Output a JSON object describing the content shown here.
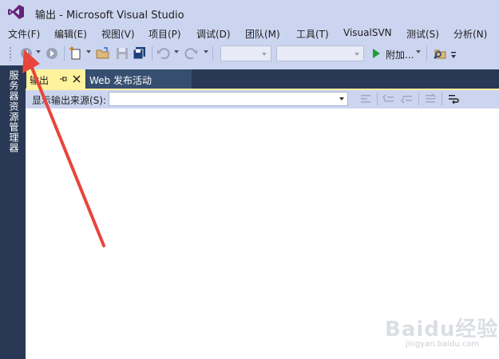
{
  "window": {
    "title": "输出 - Microsoft Visual Studio",
    "logo_icon": "visual-studio-logo-icon"
  },
  "menu": [
    {
      "label": "文件(F)"
    },
    {
      "label": "编辑(E)"
    },
    {
      "label": "视图(V)"
    },
    {
      "label": "项目(P)"
    },
    {
      "label": "调试(D)"
    },
    {
      "label": "团队(M)"
    },
    {
      "label": "工具(T)"
    },
    {
      "label": "VisualSVN"
    },
    {
      "label": "测试(S)"
    },
    {
      "label": "分析(N)"
    }
  ],
  "toolbar": {
    "attach_label": "附加...",
    "icons": [
      "back-arrow-icon",
      "forward-arrow-icon",
      "new-project-icon",
      "open-file-icon",
      "save-icon",
      "save-all-icon",
      "undo-icon",
      "redo-icon",
      "start-debug-icon",
      "find-in-files-icon"
    ],
    "config_combo_value": "",
    "platform_combo_value": ""
  },
  "side_panel": {
    "label": "服务器资源管理器"
  },
  "tabs": [
    {
      "label": "输出",
      "active": true
    },
    {
      "label": "Web 发布活动",
      "active": false
    }
  ],
  "output": {
    "source_label": "显示输出来源(S):",
    "source_value": "",
    "content": ""
  },
  "watermark": {
    "text": "Baidu经验",
    "subtext": "jingyan.baidu.com"
  },
  "colors": {
    "chrome_bg": "#ccd5f0",
    "dark_panel": "#293955",
    "active_tab": "#fff29d",
    "inactive_tab": "#364e6f",
    "annotation_arrow": "#e8453c",
    "play_green": "#1f9e32"
  }
}
